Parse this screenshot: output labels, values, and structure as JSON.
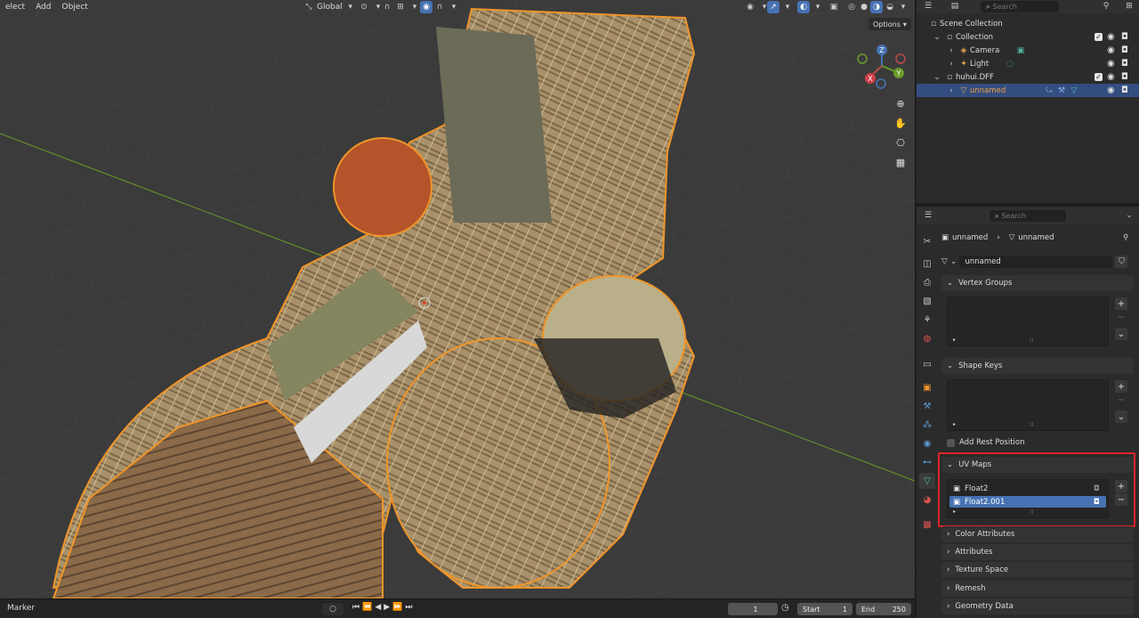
{
  "viewport": {
    "menu": [
      "elect",
      "Add",
      "Object"
    ],
    "transform_orientation": "Global",
    "options_label": "Options",
    "colors": {
      "bg": "#3b3b3b",
      "selection_outline": "#f0952a",
      "x_axis": "#b94a4a",
      "y_axis": "#6a9a2a"
    }
  },
  "gizmo": {
    "x_label": "X",
    "y_label": "Y",
    "z_label": "Z"
  },
  "outliner": {
    "search_placeholder": "Search",
    "items": [
      {
        "label": "Scene Collection"
      },
      {
        "label": "Collection"
      },
      {
        "label": "Camera"
      },
      {
        "label": "Light"
      },
      {
        "label": "huhui.DFF"
      },
      {
        "label": "unnamed"
      }
    ]
  },
  "properties": {
    "search_placeholder": "Search",
    "breadcrumb_object": "unnamed",
    "breadcrumb_mesh": "unnamed",
    "mesh_name": "unnamed",
    "panels": {
      "vertex_groups": "Vertex Groups",
      "shape_keys": "Shape Keys",
      "add_rest_position": "Add Rest Position",
      "uv_maps": "UV Maps",
      "color_attributes": "Color Attributes",
      "attributes": "Attributes",
      "texture_space": "Texture Space",
      "remesh": "Remesh",
      "geometry_data": "Geometry Data"
    },
    "uv_maps": [
      {
        "name": "Float2",
        "selected": false
      },
      {
        "name": "Float2.001",
        "selected": true
      }
    ],
    "highlight_color": "#e0242c"
  },
  "timeline": {
    "marker_label": "Marker",
    "current_frame": "1",
    "start_label": "Start",
    "start_value": "1",
    "end_label": "End",
    "end_value": "250"
  }
}
